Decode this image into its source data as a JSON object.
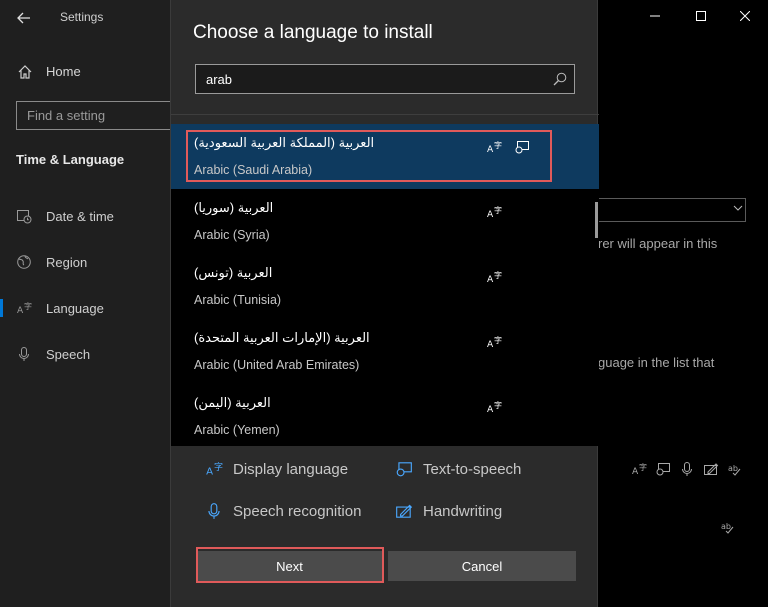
{
  "settings": {
    "app_title": "Settings",
    "home_label": "Home",
    "search_placeholder": "Find a setting",
    "section_title": "Time & Language",
    "nav": [
      {
        "label": "Date & time",
        "icon": "calendar-clock-icon"
      },
      {
        "label": "Region",
        "icon": "globe-icon"
      },
      {
        "label": "Language",
        "icon": "language-icon",
        "selected": true
      },
      {
        "label": "Speech",
        "icon": "microphone-icon"
      }
    ],
    "right_pane": {
      "partial_text_1": "rer will appear in this",
      "partial_text_2": "guage in the list that"
    }
  },
  "dialog": {
    "title": "Choose a language to install",
    "search_value": "arab",
    "languages": [
      {
        "native": "العربية (المملكة العربية السعودية)",
        "english": "Arabic (Saudi Arabia)",
        "features": [
          "display-language-icon",
          "text-to-speech-icon"
        ],
        "selected": true
      },
      {
        "native": "العربية (سوريا)",
        "english": "Arabic (Syria)",
        "features": [
          "display-language-icon"
        ]
      },
      {
        "native": "العربية (تونس)",
        "english": "Arabic (Tunisia)",
        "features": [
          "display-language-icon"
        ]
      },
      {
        "native": "العربية (الإمارات العربية المتحدة)",
        "english": "Arabic (United Arab Emirates)",
        "features": [
          "display-language-icon"
        ]
      },
      {
        "native": "العربية (اليمن)",
        "english": "Arabic (Yemen)",
        "features": [
          "display-language-icon"
        ]
      }
    ],
    "legend": {
      "display_language": "Display language",
      "text_to_speech": "Text-to-speech",
      "speech_recognition": "Speech recognition",
      "handwriting": "Handwriting"
    },
    "next_label": "Next",
    "cancel_label": "Cancel"
  },
  "colors": {
    "accent": "#0078d7",
    "selected_row": "#0e3a5f",
    "highlight_annotation": "#e05a5a"
  }
}
